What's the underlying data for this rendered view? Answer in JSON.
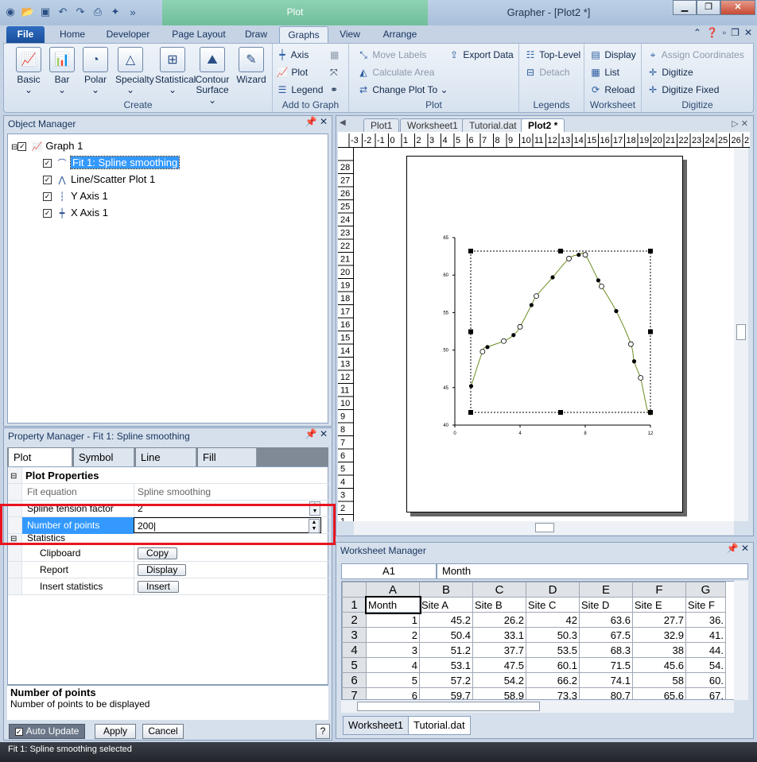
{
  "window": {
    "title": "Grapher - [Plot2 *]",
    "context_tab": "Plot"
  },
  "ribbon_tabs": [
    "File",
    "Home",
    "Developer",
    "Page Layout",
    "Draw",
    "Graphs",
    "View",
    "Arrange"
  ],
  "ribbon": {
    "create": {
      "label": "Create",
      "buttons": [
        "Basic",
        "Bar",
        "Polar",
        "Specialty",
        "Statistical",
        "Contour Surface",
        "Wizard"
      ]
    },
    "add_to_graph": {
      "label": "Add to Graph",
      "buttons": [
        "Axis",
        "Plot",
        "Legend"
      ]
    },
    "plot": {
      "label": "Plot",
      "buttons": [
        "Move Labels",
        "Calculate Area",
        "Change Plot To",
        "Export Data"
      ]
    },
    "legends": {
      "label": "Legends",
      "buttons": [
        "Top-Level",
        "Detach"
      ]
    },
    "worksheet": {
      "label": "Worksheet",
      "buttons": [
        "Display",
        "List",
        "Reload"
      ]
    },
    "digitize": {
      "label": "Digitize",
      "buttons": [
        "Assign Coordinates",
        "Digitize",
        "Digitize Fixed"
      ]
    }
  },
  "object_manager": {
    "title": "Object Manager",
    "items": [
      "Graph 1",
      "Fit 1: Spline smoothing",
      "Line/Scatter Plot 1",
      "Y Axis 1",
      "X Axis 1"
    ]
  },
  "property_manager": {
    "title": "Property Manager - Fit 1: Spline smoothing",
    "tabs": [
      "Plot",
      "Symbol",
      "Line",
      "Fill"
    ],
    "section": "Plot Properties",
    "rows": {
      "fit_equation": {
        "label": "Fit equation",
        "value": "Spline smoothing"
      },
      "tension": {
        "label": "Spline tension factor",
        "value": "2"
      },
      "points": {
        "label": "Number of points",
        "value": "200"
      },
      "statistics": {
        "label": "Statistics"
      },
      "clipboard": {
        "label": "Clipboard",
        "button": "Copy"
      },
      "report": {
        "label": "Report",
        "button": "Display"
      },
      "insert": {
        "label": "Insert statistics",
        "button": "Insert"
      }
    },
    "help_title": "Number of points",
    "help_text": "Number of points to be displayed",
    "auto_update": "Auto Update",
    "apply": "Apply",
    "cancel": "Cancel",
    "help_btn": "?"
  },
  "doc_tabs": [
    "Plot1",
    "Worksheet1",
    "Tutorial.dat",
    "Plot2 *"
  ],
  "chart_data": {
    "type": "scatter",
    "x_ticks": [
      "0",
      "4",
      "8",
      "12"
    ],
    "y_ticks": [
      "40",
      "45",
      "50",
      "55",
      "60",
      "65"
    ],
    "xlim": [
      0,
      12
    ],
    "ylim": [
      40,
      65
    ],
    "points": [
      [
        1,
        45.2
      ],
      [
        1.7,
        49.8
      ],
      [
        2,
        50.4
      ],
      [
        3,
        51.2
      ],
      [
        3.6,
        52
      ],
      [
        4,
        53.1
      ],
      [
        4.7,
        56
      ],
      [
        5,
        57.2
      ],
      [
        6,
        59.7
      ],
      [
        7,
        62.2
      ],
      [
        7.6,
        62.7
      ],
      [
        8,
        62.7
      ],
      [
        8.8,
        59.3
      ],
      [
        9,
        58.5
      ],
      [
        9.9,
        55.2
      ],
      [
        10.8,
        50.8
      ],
      [
        11,
        48.5
      ],
      [
        11.4,
        46.3
      ]
    ]
  },
  "worksheet_manager": {
    "title": "Worksheet Manager",
    "cell_ref": "A1",
    "cell_value": "Month",
    "columns": [
      "A",
      "B",
      "C",
      "D",
      "E",
      "F",
      "G"
    ],
    "rows": [
      [
        "Month",
        "Site A",
        "Site B",
        "Site C",
        "Site D",
        "Site E",
        "Site F"
      ],
      [
        "1",
        "45.2",
        "26.2",
        "42",
        "63.6",
        "27.7",
        "36."
      ],
      [
        "2",
        "50.4",
        "33.1",
        "50.3",
        "67.5",
        "32.9",
        "41."
      ],
      [
        "3",
        "51.2",
        "37.7",
        "53.5",
        "68.3",
        "38",
        "44."
      ],
      [
        "4",
        "53.1",
        "47.5",
        "60.1",
        "71.5",
        "45.6",
        "54."
      ],
      [
        "5",
        "57.2",
        "54.2",
        "66.2",
        "74.1",
        "58",
        "60."
      ],
      [
        "6",
        "59.7",
        "58.9",
        "73.3",
        "80.7",
        "65.6",
        "67."
      ]
    ],
    "sheet_tabs": [
      "Worksheet1",
      "Tutorial.dat"
    ]
  },
  "status": "Fit 1: Spline smoothing selected"
}
